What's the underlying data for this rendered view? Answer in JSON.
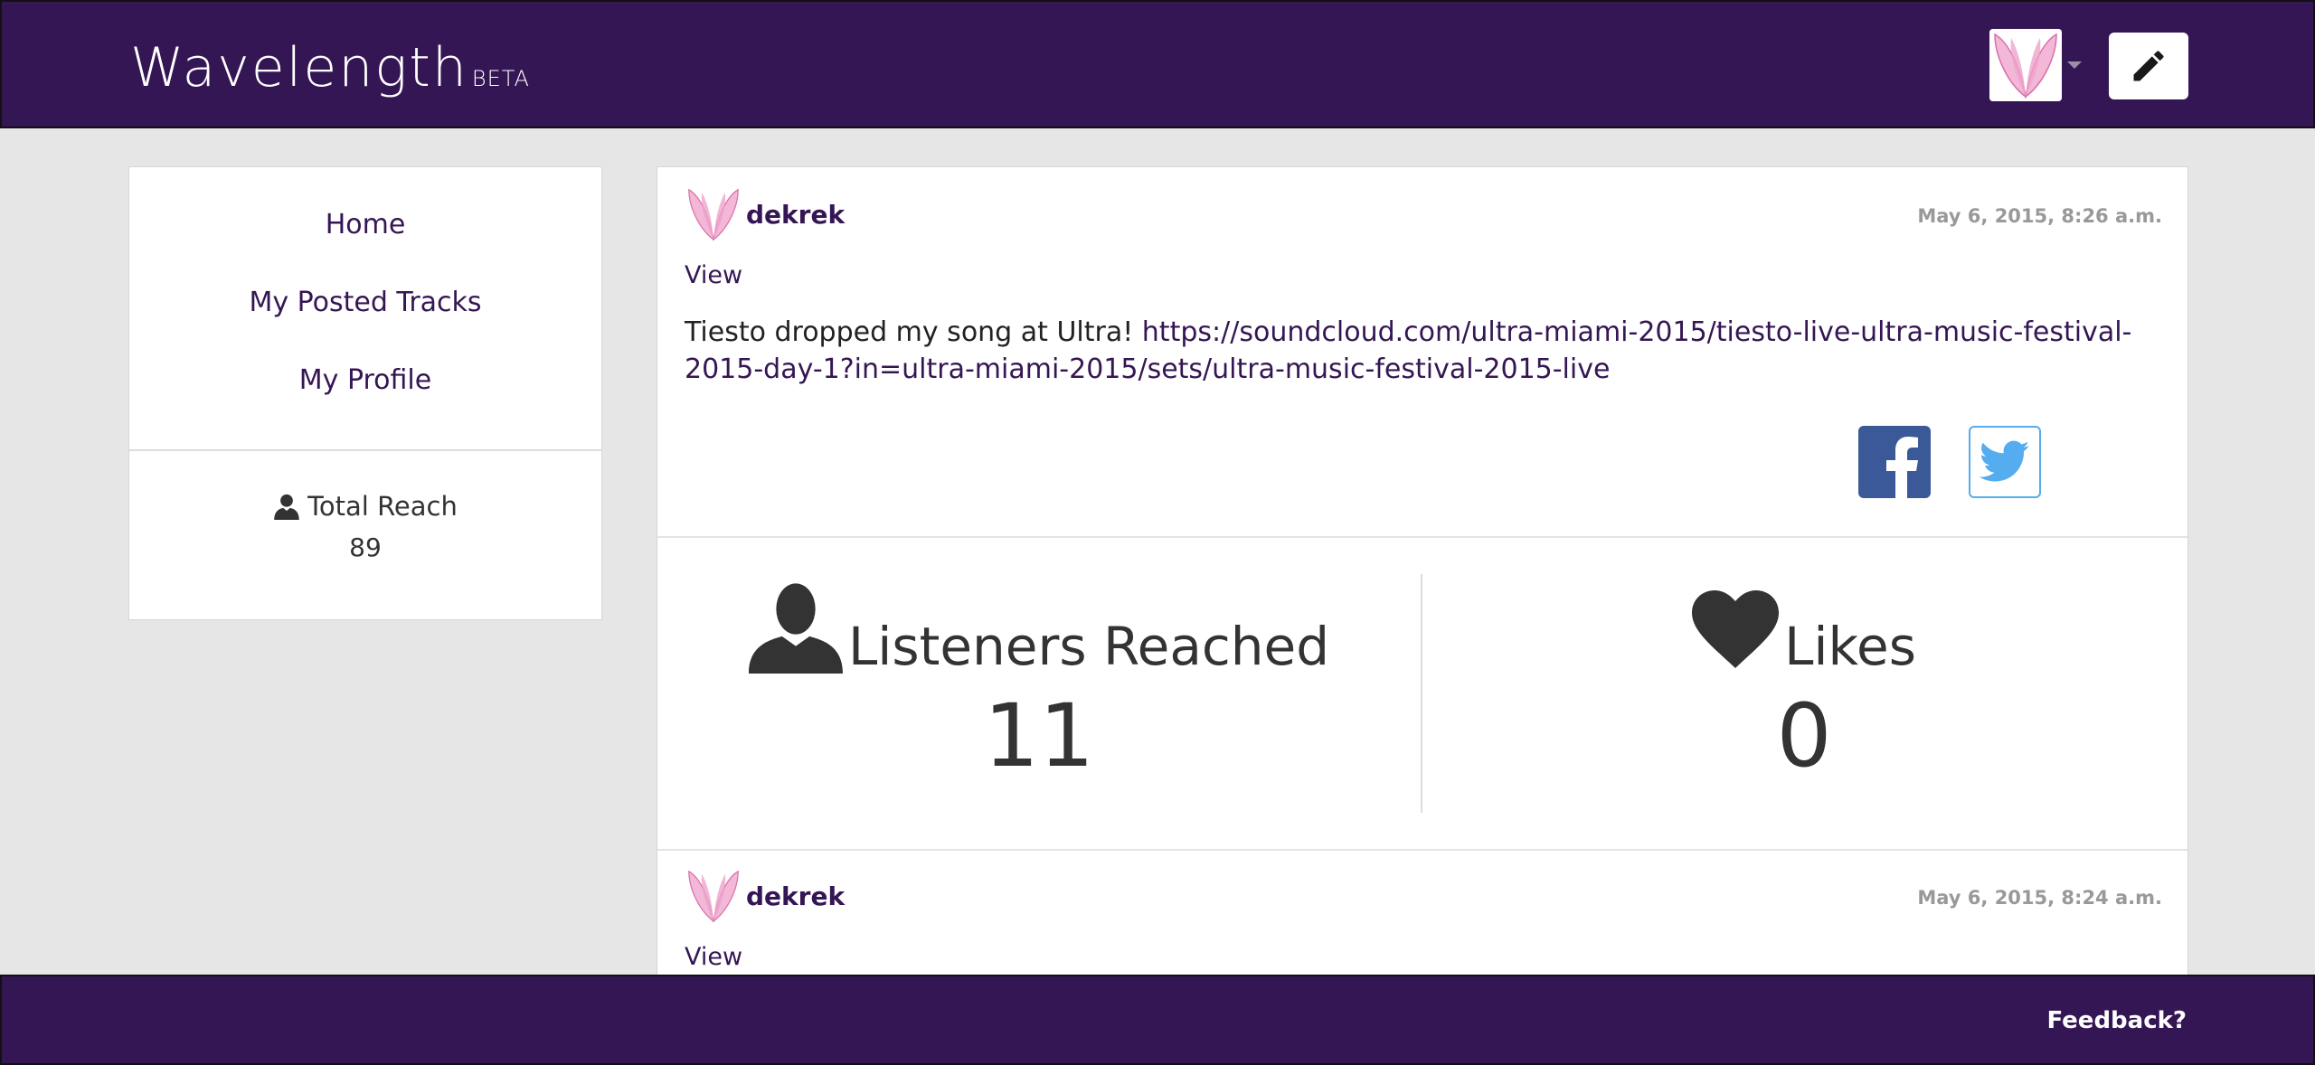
{
  "header": {
    "brand_name": "Wavelength",
    "brand_tag": "BETA",
    "avatar_icon": "pink-butterfly-avatar-icon",
    "compose_icon": "pencil-icon"
  },
  "sidebar": {
    "nav": [
      {
        "label": "Home"
      },
      {
        "label": "My Posted Tracks"
      },
      {
        "label": "My Profile"
      }
    ],
    "reach": {
      "label": "Total Reach",
      "value": "89",
      "icon": "user-icon"
    }
  },
  "posts": [
    {
      "username": "dekrek",
      "timestamp": "May 6, 2015, 8:26 a.m.",
      "view_label": "View",
      "text": "Tiesto dropped my song at Ultra!",
      "link": "https://soundcloud.com/ultra-miami-2015/tiesto-live-ultra-music-festival-2015-day-1?in=ultra-miami-2015/sets/ultra-music-festival-2015-live",
      "stats": {
        "listeners_label": "Listeners Reached",
        "listeners_value": "11",
        "likes_label": "Likes",
        "likes_value": "0"
      }
    },
    {
      "username": "dekrek",
      "timestamp": "May 6, 2015, 8:24 a.m.",
      "view_label": "View"
    }
  ],
  "footer": {
    "feedback_label": "Feedback?"
  },
  "colors": {
    "brand": "#351654",
    "background": "#e6e6e6",
    "facebook": "#3b5998",
    "twitter": "#55acee"
  }
}
